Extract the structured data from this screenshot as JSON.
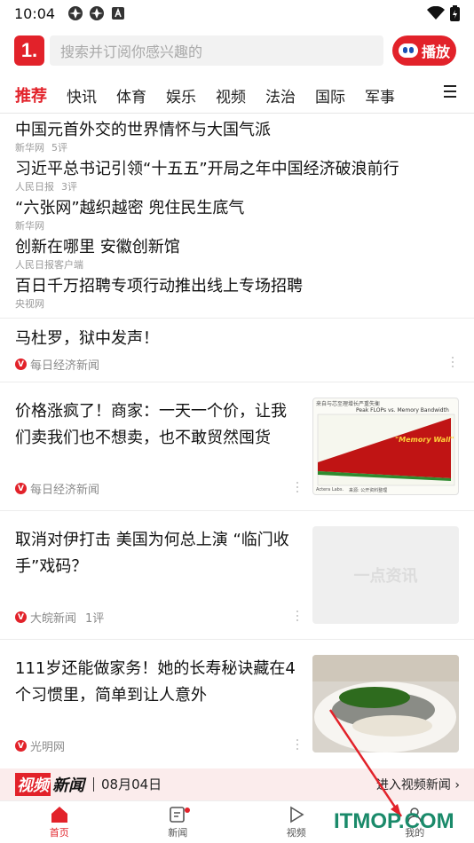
{
  "status": {
    "time": "10:04"
  },
  "header": {
    "logo": "1.",
    "search_placeholder": "搜索并订阅你感兴趣的",
    "play_label": "播放"
  },
  "tabs": [
    "推荐",
    "快讯",
    "体育",
    "娱乐",
    "视频",
    "法治",
    "国际",
    "军事"
  ],
  "top_news": [
    {
      "title": "中国元首外交的世界情怀与大国气派",
      "source": "新华网",
      "comments": "5评"
    },
    {
      "title": "习近平总书记引领“十五五”开局之年中国经济破浪前行",
      "source": "人民日报",
      "comments": "3评"
    },
    {
      "title": "“六张网”越织越密 兜住民生底气",
      "source": "新华网",
      "comments": ""
    },
    {
      "title": "创新在哪里 安徽创新馆",
      "source": "人民日报客户端",
      "comments": ""
    },
    {
      "title": "百日千万招聘专项行动推出线上专场招聘",
      "source": "央视网",
      "comments": ""
    }
  ],
  "cards": [
    {
      "title": "马杜罗，狱中发声！",
      "source": "每日经济新闻",
      "comments": ""
    },
    {
      "title_line1": "价格涨疯了！商家：一天一个价，让我",
      "title_line2": "们卖我们也不想卖，也不敢贸然囤货",
      "source": "每日经济新闻",
      "comments": "",
      "thumb": {
        "header": "来自与芯至理增长严重失衡",
        "chart_title": "Peak FLOPs vs. Memory Bandwidth",
        "label": "\"Memory Wall\"",
        "footer_left": "Actera Labs.",
        "footer_right": "来源: 公开资料整理"
      }
    },
    {
      "title_line1": "取消对伊打击 美国为何总上演 “临门收",
      "title_line2": "手”戏码？",
      "source": "大皖新闻",
      "comments": "1评",
      "thumb": {
        "placeholder": "一点资讯"
      }
    },
    {
      "title_line1": "111岁还能做家务！她的长寿秘诀藏在4",
      "title_line2": "个习惯里，简单到让人意外",
      "source": "光明网",
      "comments": ""
    }
  ],
  "video_banner": {
    "logo_red": "视频",
    "logo_black": "新闻",
    "date": "08月04日",
    "link": "进入视频新闻 ›"
  },
  "bottom_nav": [
    "首页",
    "新闻",
    "视频",
    "我的"
  ],
  "watermark": "ITMOP.COM",
  "colors": {
    "brand": "#e2222a",
    "watermark": "#1a8a6a"
  }
}
